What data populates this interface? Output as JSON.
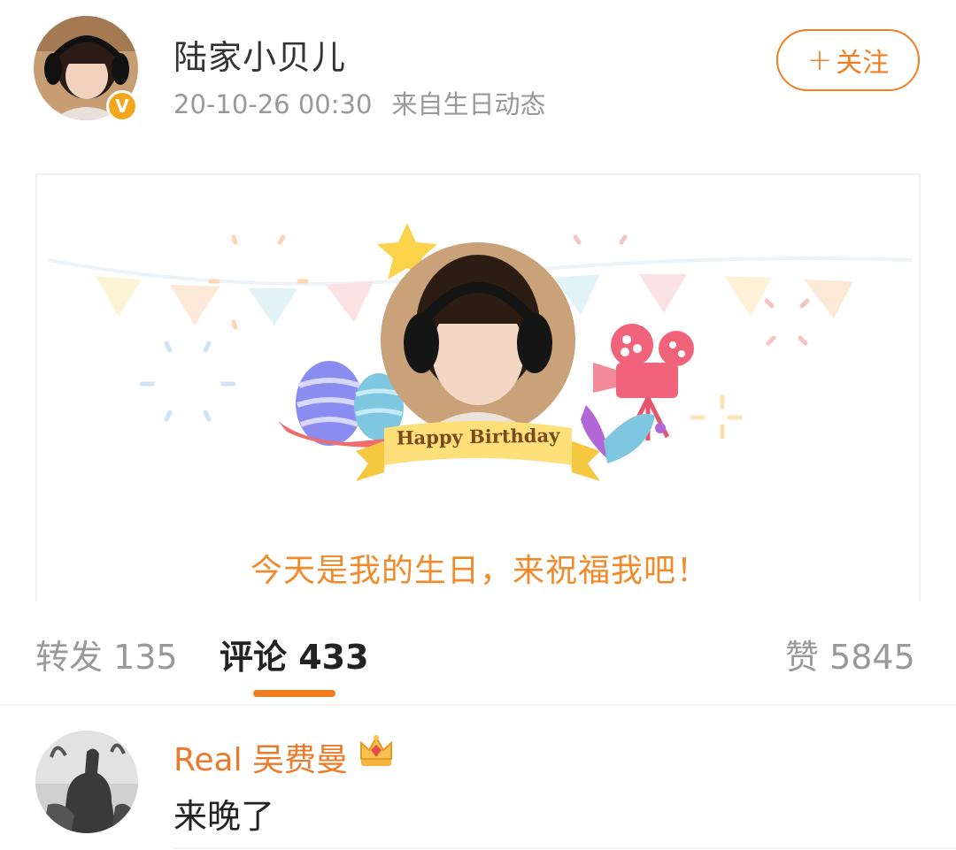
{
  "header": {
    "username": "陆家小贝儿",
    "timestamp": "20-10-26 00:30",
    "source": "来自生日动态",
    "verified_badge": "V",
    "follow_plus": "+",
    "follow_label": "关注"
  },
  "card": {
    "banner_text": "Happy Birthday",
    "caption": "今天是我的生日，来祝福我吧！"
  },
  "tabs": {
    "repost": "转发 135",
    "comment": "评论 433",
    "like": "赞 5845"
  },
  "comments": [
    {
      "name": "Real 吴费曼",
      "text": "来晚了",
      "badge_icon": "crown-icon"
    }
  ],
  "colors": {
    "accent": "#f07d22",
    "verified": "#f4a51c",
    "caption": "#f08a2a",
    "comment_name": "#eb7a2a"
  }
}
